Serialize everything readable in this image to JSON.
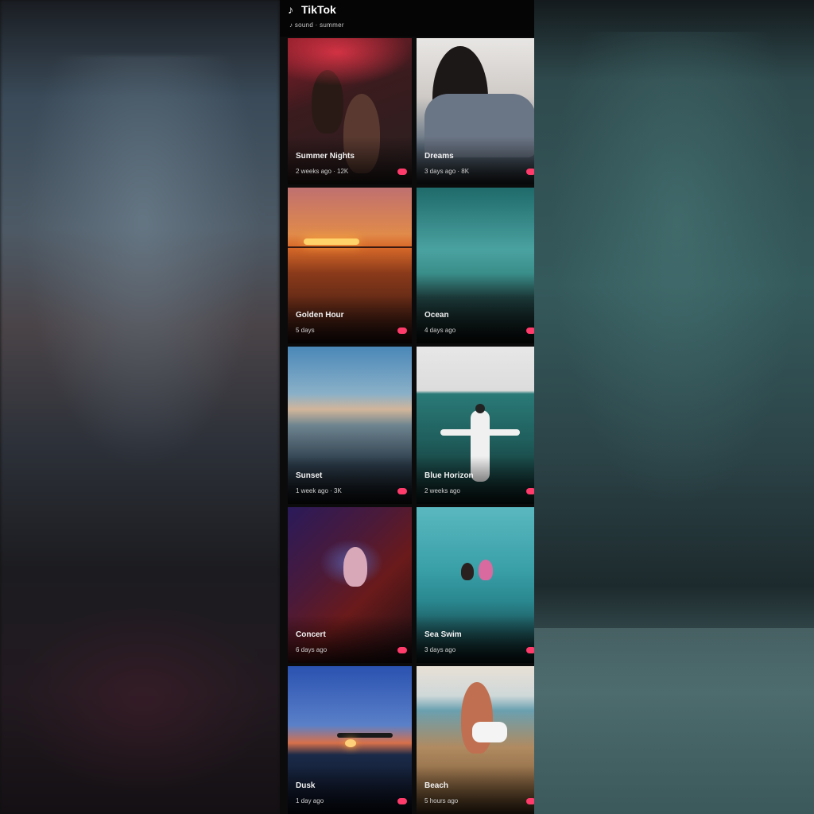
{
  "app": {
    "title": "TikTok",
    "subtitle": "♪ sound · summer"
  },
  "cards": [
    {
      "title": "Summer Nights",
      "meta": "2 weeks ago · 12K"
    },
    {
      "title": "Dreams",
      "meta": "3 days ago · 8K"
    },
    {
      "title": "Golden Hour",
      "meta": "5 days"
    },
    {
      "title": "Ocean",
      "meta": "4 days ago"
    },
    {
      "title": "Sunset",
      "meta": "1 week ago · 3K"
    },
    {
      "title": "Blue Horizon",
      "meta": "2 weeks ago"
    },
    {
      "title": "Concert",
      "meta": "6 days ago"
    },
    {
      "title": "Sea Swim",
      "meta": "3 days ago"
    },
    {
      "title": "Dusk",
      "meta": "1 day ago"
    },
    {
      "title": "Beach",
      "meta": "5 hours ago"
    }
  ],
  "colors": {
    "accent": "#ff3b6b",
    "background": "#0b0b0c"
  }
}
